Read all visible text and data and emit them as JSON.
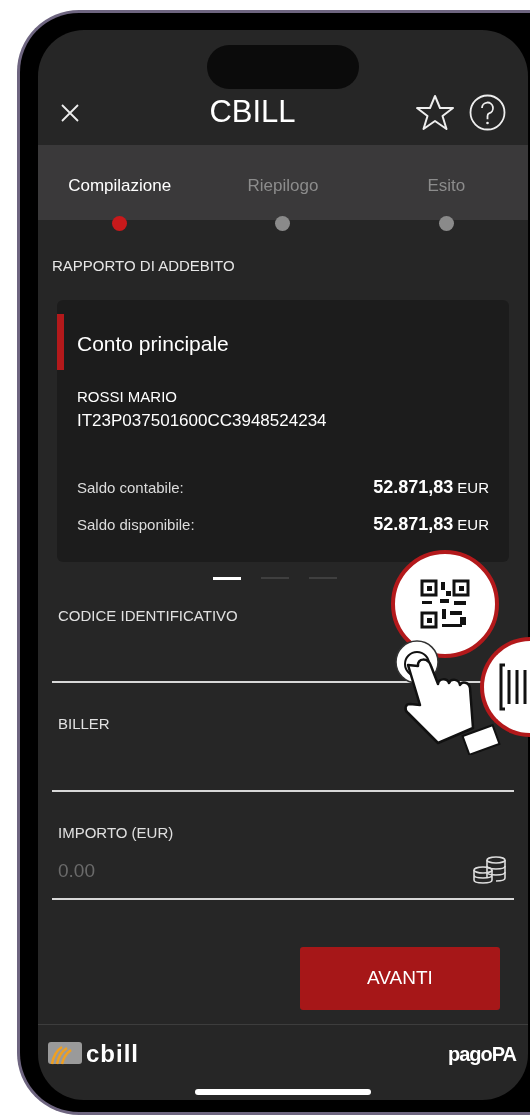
{
  "header": {
    "title": "CBILL"
  },
  "steps": [
    {
      "label": "Compilazione",
      "selected": true
    },
    {
      "label": "Riepilogo",
      "selected": false
    },
    {
      "label": "Esito",
      "selected": false
    }
  ],
  "section_title": "RAPPORTO DI ADDEBITO",
  "account_card": {
    "name": "Conto principale",
    "holder": "ROSSI MARIO",
    "iban": "IT23P037501600CC3948524234",
    "balances": [
      {
        "label": "Saldo contabile:",
        "amount": "52.871,83",
        "currency": "EUR"
      },
      {
        "label": "Saldo disponibile:",
        "amount": "52.871,83",
        "currency": "EUR"
      }
    ]
  },
  "pager": [
    {
      "selected": true
    },
    {
      "selected": false
    },
    {
      "selected": false
    }
  ],
  "fields": [
    {
      "kind": "qr",
      "label": "CODICE IDENTIFICATIVO"
    },
    {
      "kind": "biller",
      "label": "BILLER"
    },
    {
      "kind": "amount",
      "label": "IMPORTO (EUR)",
      "placeholder": "0.00"
    }
  ],
  "next_button": "AVANTI",
  "footer": {
    "left_logo": "cbill",
    "right_logo": "pagoPA"
  }
}
